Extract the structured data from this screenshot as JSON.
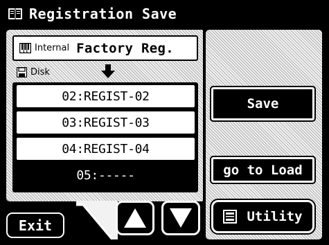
{
  "title_bar": {
    "icon": "book-icon",
    "title": "Registration Save"
  },
  "source": {
    "icon": "keyboard-icon",
    "kind": "Internal",
    "name": "Factory Reg."
  },
  "destination": {
    "icon": "disk-icon",
    "label": "Disk",
    "arrow_icon": "arrow-down-icon"
  },
  "list": {
    "rows": [
      {
        "label": "02:REGIST-02",
        "selected": false
      },
      {
        "label": "03:REGIST-03",
        "selected": false
      },
      {
        "label": "04:REGIST-04",
        "selected": false
      },
      {
        "label": "05:-----",
        "selected": true
      }
    ]
  },
  "buttons": {
    "exit": "Exit",
    "save": "Save",
    "go_to_load": "go to Load",
    "utility": "Utility",
    "utility_icon": "utility-icon",
    "up_icon": "up-triangle-icon",
    "down_icon": "down-triangle-icon"
  },
  "colors": {
    "foreground": "#000000",
    "background": "#ffffff",
    "hatch": "#f2f2f2"
  }
}
